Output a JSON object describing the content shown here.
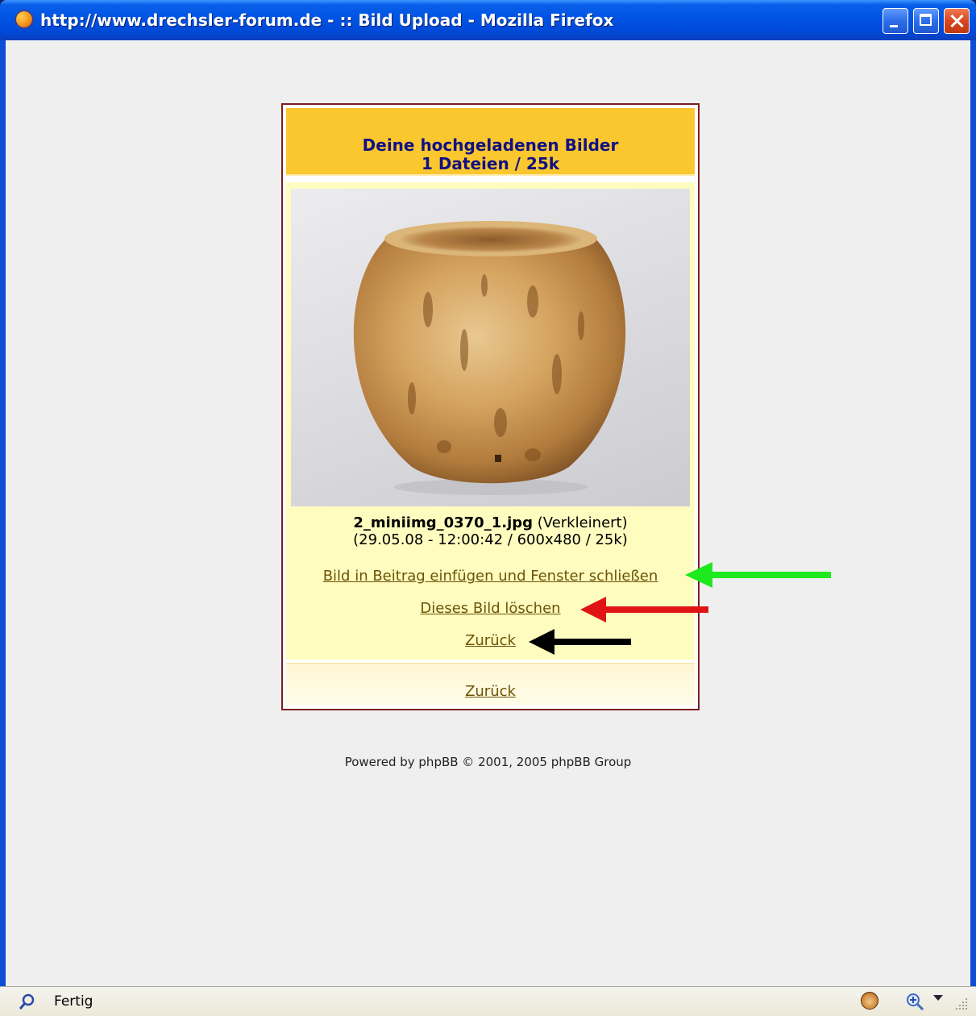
{
  "window": {
    "title": "http://www.drechsler-forum.de - :: Bild Upload - Mozilla Firefox"
  },
  "upload_panel": {
    "header_line1": "Deine hochgeladenen Bilder",
    "header_line2": "1 Dateien / 25k",
    "image": {
      "filename": "2_miniimg_0370_1.jpg",
      "scaled_note": "(Verkleinert)",
      "details": "(29.05.08 - 12:00:42 / 600x480 / 25k)"
    },
    "links": {
      "insert_and_close": "Bild in Beitrag einfügen und Fenster schließen",
      "delete": "Dieses Bild löschen",
      "back": "Zurück",
      "back_footer": "Zurück"
    }
  },
  "annotations": {
    "arrow_colors": [
      "#1ee81e",
      "#e01414",
      "#000000"
    ]
  },
  "footer": {
    "powered_by": "Powered by phpBB © 2001, 2005 phpBB Group"
  },
  "statusbar": {
    "text": "Fertig",
    "icons": [
      "find-icon",
      "monkey-icon",
      "zoom-icon",
      "dropdown-icon",
      "resize-grip-icon"
    ]
  }
}
